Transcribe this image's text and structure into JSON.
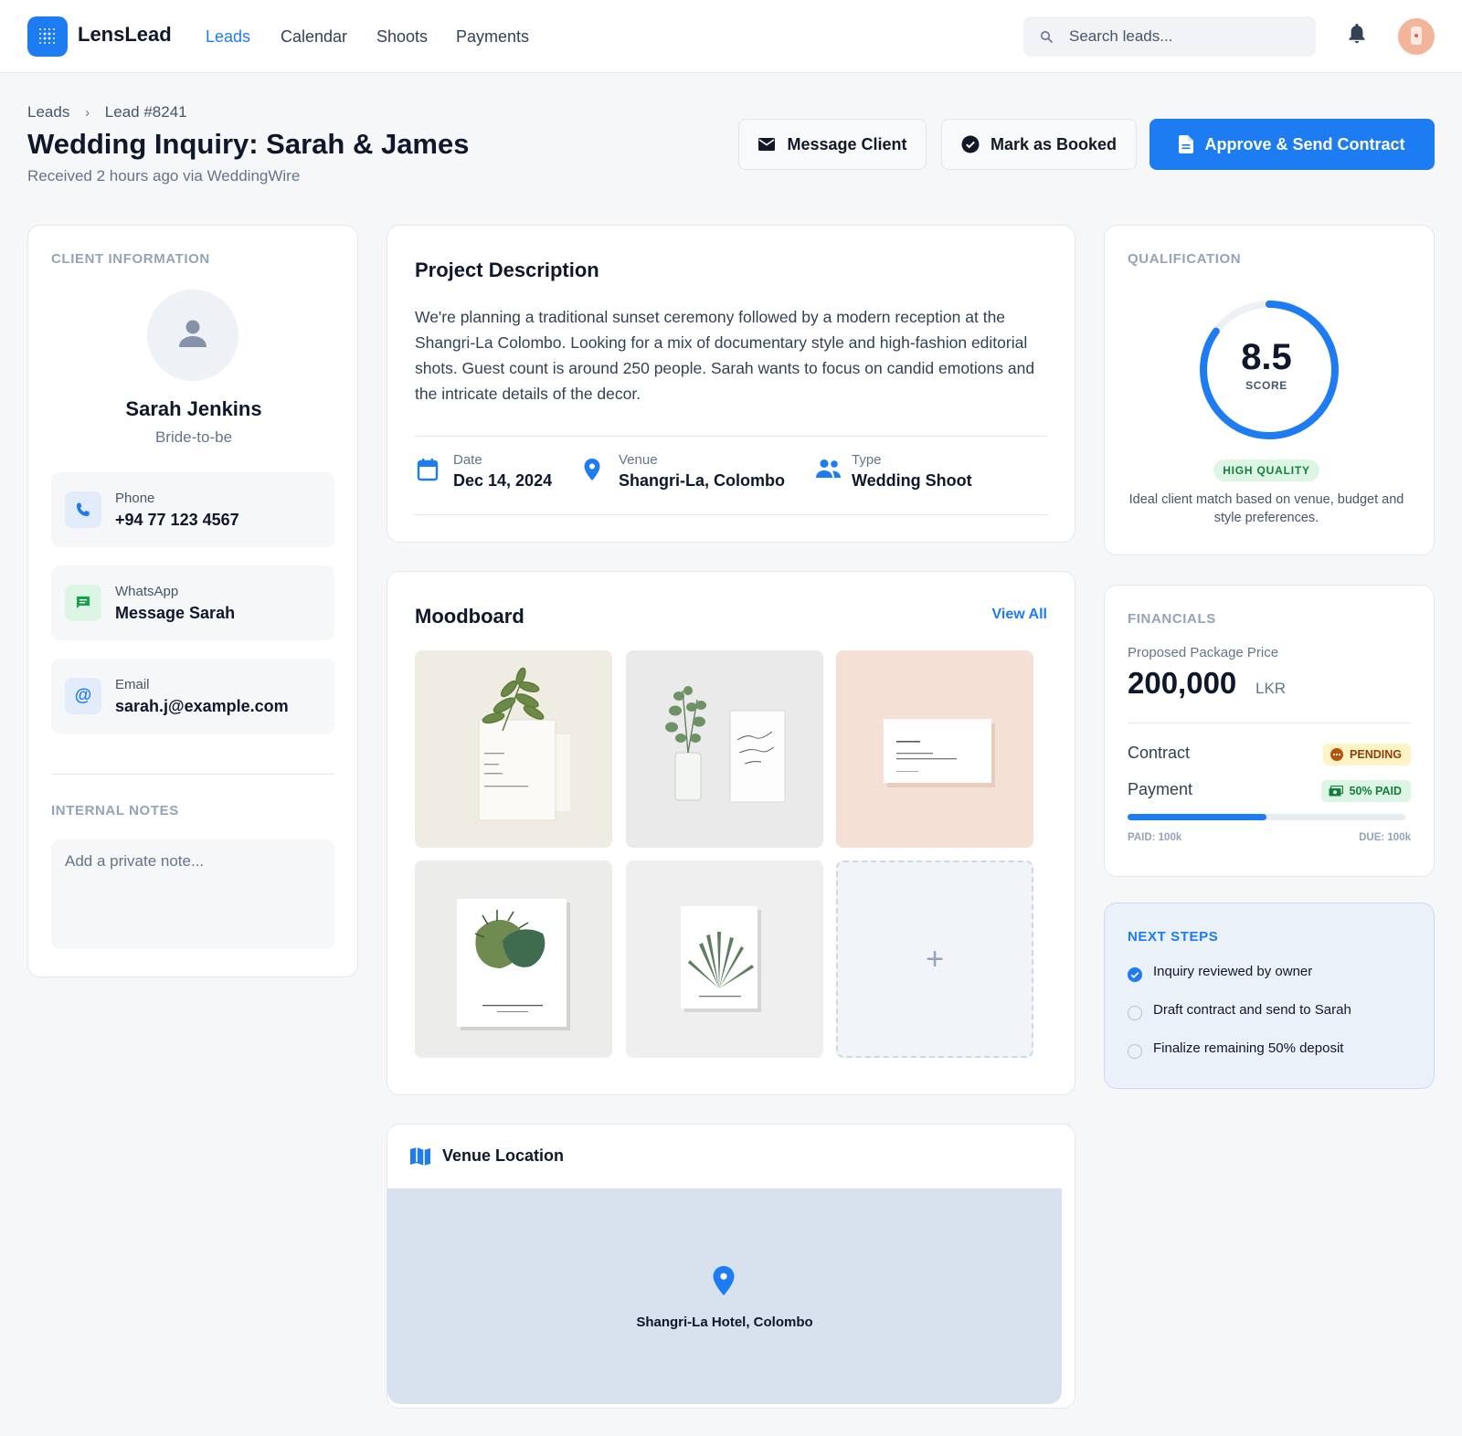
{
  "app": {
    "name": "LensLead"
  },
  "nav": {
    "items": [
      {
        "label": "Leads",
        "active": true
      },
      {
        "label": "Calendar",
        "active": false
      },
      {
        "label": "Shoots",
        "active": false
      },
      {
        "label": "Payments",
        "active": false
      }
    ]
  },
  "search": {
    "placeholder": "Search leads..."
  },
  "breadcrumb": {
    "root": "Leads",
    "current": "Lead #8241"
  },
  "page": {
    "title": "Wedding Inquiry: Sarah & James",
    "subtitle": "Received 2 hours ago via WeddingWire"
  },
  "actions": {
    "message": "Message Client",
    "booked": "Mark as Booked",
    "approve": "Approve & Send Contract"
  },
  "client": {
    "section_label": "CLIENT INFORMATION",
    "name": "Sarah Jenkins",
    "role": "Bride-to-be",
    "contacts": [
      {
        "label": "Phone",
        "value": "+94 77 123 4567",
        "icon": "phone-icon"
      },
      {
        "label": "WhatsApp",
        "value": "Message Sarah",
        "icon": "chat-icon"
      },
      {
        "label": "Email",
        "value": "sarah.j@example.com",
        "icon": "at-icon"
      }
    ],
    "notes_label": "INTERNAL NOTES",
    "notes_placeholder": "Add a private note..."
  },
  "project": {
    "title": "Project Description",
    "description": "We're planning a traditional sunset ceremony followed by a modern reception at the Shangri-La Colombo. Looking for a mix of documentary style and high-fashion editorial shots. Guest count is around 250 people. Sarah wants to focus on candid emotions and the intricate details of the decor.",
    "meta": [
      {
        "label": "Date",
        "value": "Dec 14, 2024",
        "icon": "calendar-icon"
      },
      {
        "label": "Venue",
        "value": "Shangri-La, Colombo",
        "icon": "map-pin-icon"
      },
      {
        "label": "Type",
        "value": "Wedding Shoot",
        "icon": "people-icon"
      }
    ]
  },
  "moodboard": {
    "title": "Moodboard",
    "view_all": "View All",
    "add_label": "+"
  },
  "venue": {
    "title": "Venue Location",
    "place": "Shangri-La Hotel, Colombo"
  },
  "qualification": {
    "section_label": "QUALIFICATION",
    "score": "8.5",
    "score_value": 8.5,
    "score_max": 10,
    "score_label": "SCORE",
    "badge": "HIGH QUALITY",
    "description": "Ideal client match based on venue, budget and style preferences."
  },
  "financials": {
    "section_label": "FINANCIALS",
    "price_label": "Proposed Package Price",
    "price": "200,000",
    "currency": "LKR",
    "contract_label": "Contract",
    "contract_status": "PENDING",
    "payment_label": "Payment",
    "payment_status": "50% PAID",
    "paid_fraction": 0.5,
    "paid_label": "PAID: 100k",
    "due_label": "DUE: 100k"
  },
  "next_steps": {
    "section_label": "NEXT STEPS",
    "items": [
      {
        "label": "Inquiry reviewed by owner",
        "done": true
      },
      {
        "label": "Draft contract and send to Sarah",
        "done": false
      },
      {
        "label": "Finalize remaining 50% deposit",
        "done": false
      }
    ]
  },
  "colors": {
    "primary": "#1d7cf2",
    "success": "#15803d",
    "warning": "#92400e",
    "background": "#f6f7f9"
  }
}
